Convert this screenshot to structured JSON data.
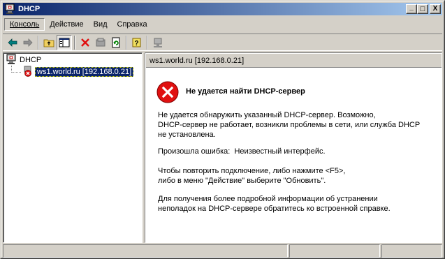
{
  "window": {
    "title": "DHCP",
    "icon": "dhcp-console-icon"
  },
  "title_buttons": {
    "minimize": "_",
    "maximize": "□",
    "close": "X"
  },
  "menu": {
    "items": [
      {
        "label": "Консоль",
        "active": true
      },
      {
        "label": "Действие",
        "active": false
      },
      {
        "label": "Вид",
        "active": false
      },
      {
        "label": "Справка",
        "active": false
      }
    ]
  },
  "toolbar": {
    "icons": [
      "back-arrow-icon",
      "forward-arrow-icon",
      "up-folder-icon",
      "show-hide-tree-icon",
      "delete-icon",
      "properties-icon",
      "refresh-icon",
      "help-icon",
      "server-icon"
    ]
  },
  "tree": {
    "root_label": "DHCP",
    "child_label": "ws1.world.ru [192.168.0.21]"
  },
  "right_pane": {
    "header": "ws1.world.ru [192.168.0.21]",
    "error_title": "Не удается найти DHCP-сервер",
    "para1": [
      "Не удается обнаружить указанный DHCP-сервер. Возможно,",
      "DHCP-сервер не работает, возникли проблемы в сети, или служба DHCP",
      "не установлена."
    ],
    "para2": [
      "Произошла ошибка:  Неизвестный интерфейс."
    ],
    "para3": [
      "Чтобы повторить подключение, либо нажмите <F5>,",
      "либо в меню \"Действие\" выберите \"Обновить\"."
    ],
    "para4": [
      "Для получения более подробной информации об устранении",
      "неполадок на DHCP-сервере обратитесь ко встроенной справке."
    ]
  },
  "colors": {
    "title_gradient_start": "#0a246a",
    "title_gradient_end": "#a6caf0",
    "error_red": "#e01010",
    "selection": "#0a246a"
  }
}
